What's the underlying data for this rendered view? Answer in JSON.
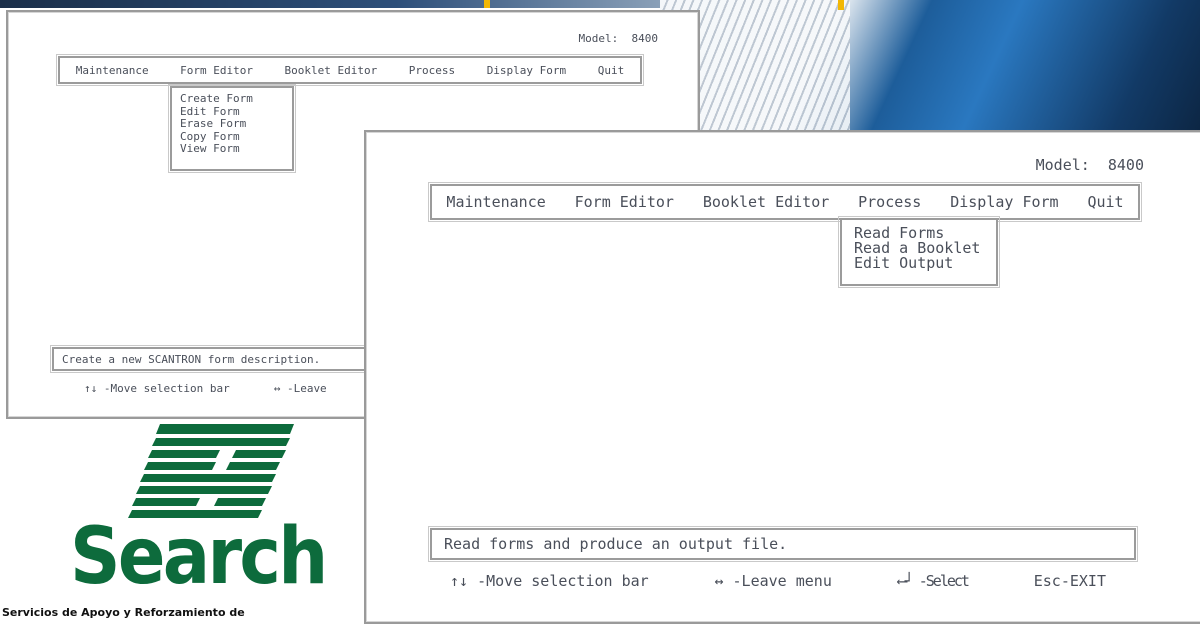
{
  "colors": {
    "screen_text": "#4a4f5a",
    "logo_green": "#0d6b3c",
    "accent_yellow": "#f2b705",
    "background_blue": "#1d5d9a"
  },
  "screen_back": {
    "model_label": "Model:  8400",
    "menu": [
      "Maintenance",
      "Form Editor",
      "Booklet Editor",
      "Process",
      "Display Form",
      "Quit"
    ],
    "open_menu": "Form Editor",
    "dropdown": [
      "Create Form",
      "Edit Form",
      "Erase Form",
      "Copy Form",
      "View Form"
    ],
    "status": "Create a new SCANTRON form description.",
    "hints": [
      "↑↓ -Move selection bar",
      "↔ -Leave"
    ]
  },
  "screen_front": {
    "model_label": "Model:  8400",
    "menu": [
      "Maintenance",
      "Form Editor",
      "Booklet Editor",
      "Process",
      "Display Form",
      "Quit"
    ],
    "open_menu": "Process",
    "dropdown": [
      "Read Forms",
      "Read a Booklet",
      "Edit Output"
    ],
    "status": "Read forms and produce an output file.",
    "hints": [
      "↑↓ -Move selection bar",
      "↔ -Leave menu",
      "⟵┘ -Select",
      "Esc-EXIT"
    ]
  },
  "logo": {
    "word": "Search",
    "tagline": "Servicios de Apoyo y Reforzamiento de"
  }
}
